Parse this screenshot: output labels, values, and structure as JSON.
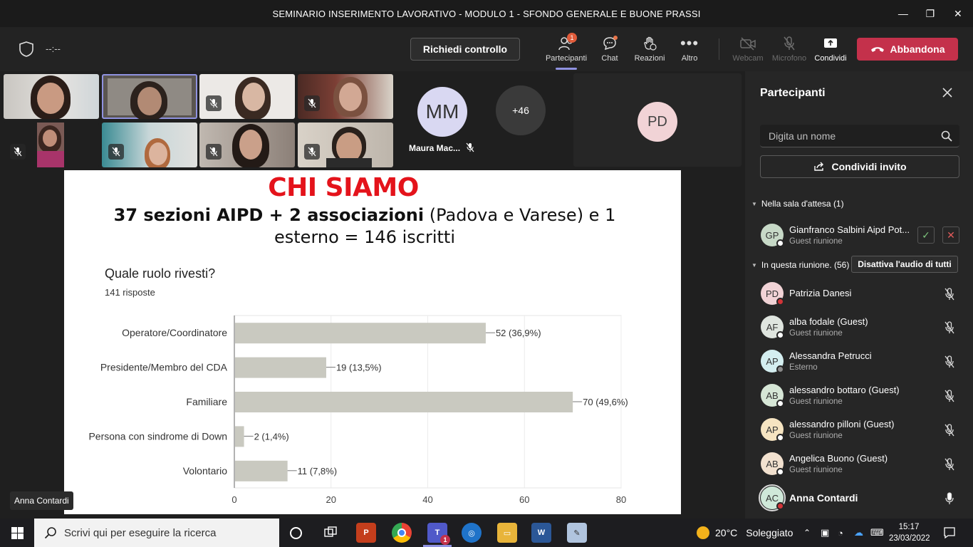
{
  "window": {
    "title": "SEMINARIO INSERIMENTO LAVORATIVO - MODULO 1 - SFONDO GENERALE E BUONE PRASSI",
    "minimize": "—",
    "maximize": "❐",
    "close": "✕"
  },
  "toolbar": {
    "timer": "--:--",
    "request_control": "Richiedi controllo",
    "participants": "Partecipanti",
    "participants_badge": "1",
    "chat": "Chat",
    "reactions": "Reazioni",
    "more": "Altro",
    "webcam": "Webcam",
    "microphone": "Microfono",
    "share": "Condividi",
    "leave": "Abbandona"
  },
  "stage": {
    "mm_initials": "MM",
    "mm_name": "Maura Mac...",
    "more_count": "+46",
    "pd_initials": "PD",
    "speaker_name": "Anna Contardi"
  },
  "slide": {
    "title": "CHI SIAMO",
    "line1_a": "37 sezioni AIPD + 2 associazioni",
    "line1_b": " (Padova e Varese) e 1",
    "line2": "esterno = 146 iscritti",
    "question": "Quale ruolo rivesti?",
    "responses": "141 risposte"
  },
  "chart_data": {
    "type": "bar",
    "orientation": "horizontal",
    "title": "Quale ruolo rivesti?",
    "subtitle": "141 risposte",
    "categories": [
      "Operatore/Coordinatore",
      "Presidente/Membro del CDA",
      "Familiare",
      "Persona con sindrome di Down",
      "Volontario"
    ],
    "values": [
      52,
      19,
      70,
      2,
      11
    ],
    "data_labels": [
      "52 (36,9%)",
      "19 (13,5%)",
      "70 (49,6%)",
      "2 (1,4%)",
      "11 (7,8%)"
    ],
    "xlim": [
      0,
      80
    ],
    "x_ticks": [
      "0",
      "20",
      "40",
      "60",
      "80"
    ],
    "bar_color": "#c9c9c0",
    "grid": true
  },
  "panel": {
    "title": "Partecipanti",
    "search_placeholder": "Digita un nome",
    "invite": "Condividi invito",
    "waiting_label": "Nella sala d'attesa (1)",
    "in_meeting_label": "In questa riunione. (56)",
    "mute_all": "Disattiva l'audio di tutti",
    "waiting": [
      {
        "initials": "GP",
        "name": "Gianfranco Salbini Aipd Pot...",
        "role": "Guest riunione",
        "avatar_color": "#c7d9c7",
        "status_color": "#ffffff"
      }
    ],
    "people": [
      {
        "initials": "PD",
        "name": "Patrizia Danesi",
        "role": "",
        "avatar_color": "#f1d3d6",
        "status_color": "#d13438"
      },
      {
        "initials": "AF",
        "name": "alba fodale (Guest)",
        "role": "Guest riunione",
        "avatar_color": "#dfe5df",
        "status_color": "#ffffff"
      },
      {
        "initials": "AP",
        "name": "Alessandra Petrucci",
        "role": "Esterno",
        "avatar_color": "#d4eef0",
        "status_color": "#8a8a8a"
      },
      {
        "initials": "AB",
        "name": "alessandro bottaro (Guest)",
        "role": "Guest riunione",
        "avatar_color": "#d6e6d6",
        "status_color": "#ffffff"
      },
      {
        "initials": "AP",
        "name": "alessandro pilloni (Guest)",
        "role": "Guest riunione",
        "avatar_color": "#f6e4c1",
        "status_color": "#ffffff"
      },
      {
        "initials": "AB",
        "name": "Angelica Buono (Guest)",
        "role": "Guest riunione",
        "avatar_color": "#f2e1cf",
        "status_color": "#ffffff"
      },
      {
        "initials": "AC",
        "name": "Anna Contardi",
        "role": "",
        "avatar_color": "#cfe8d9",
        "status_color": "#d13438"
      }
    ]
  },
  "taskbar": {
    "search_placeholder": "Scrivi qui per eseguire la ricerca",
    "teams_badge": "1",
    "weather_temp": "20°C",
    "weather_desc": "Soleggiato",
    "time": "15:17",
    "date": "23/03/2022"
  }
}
